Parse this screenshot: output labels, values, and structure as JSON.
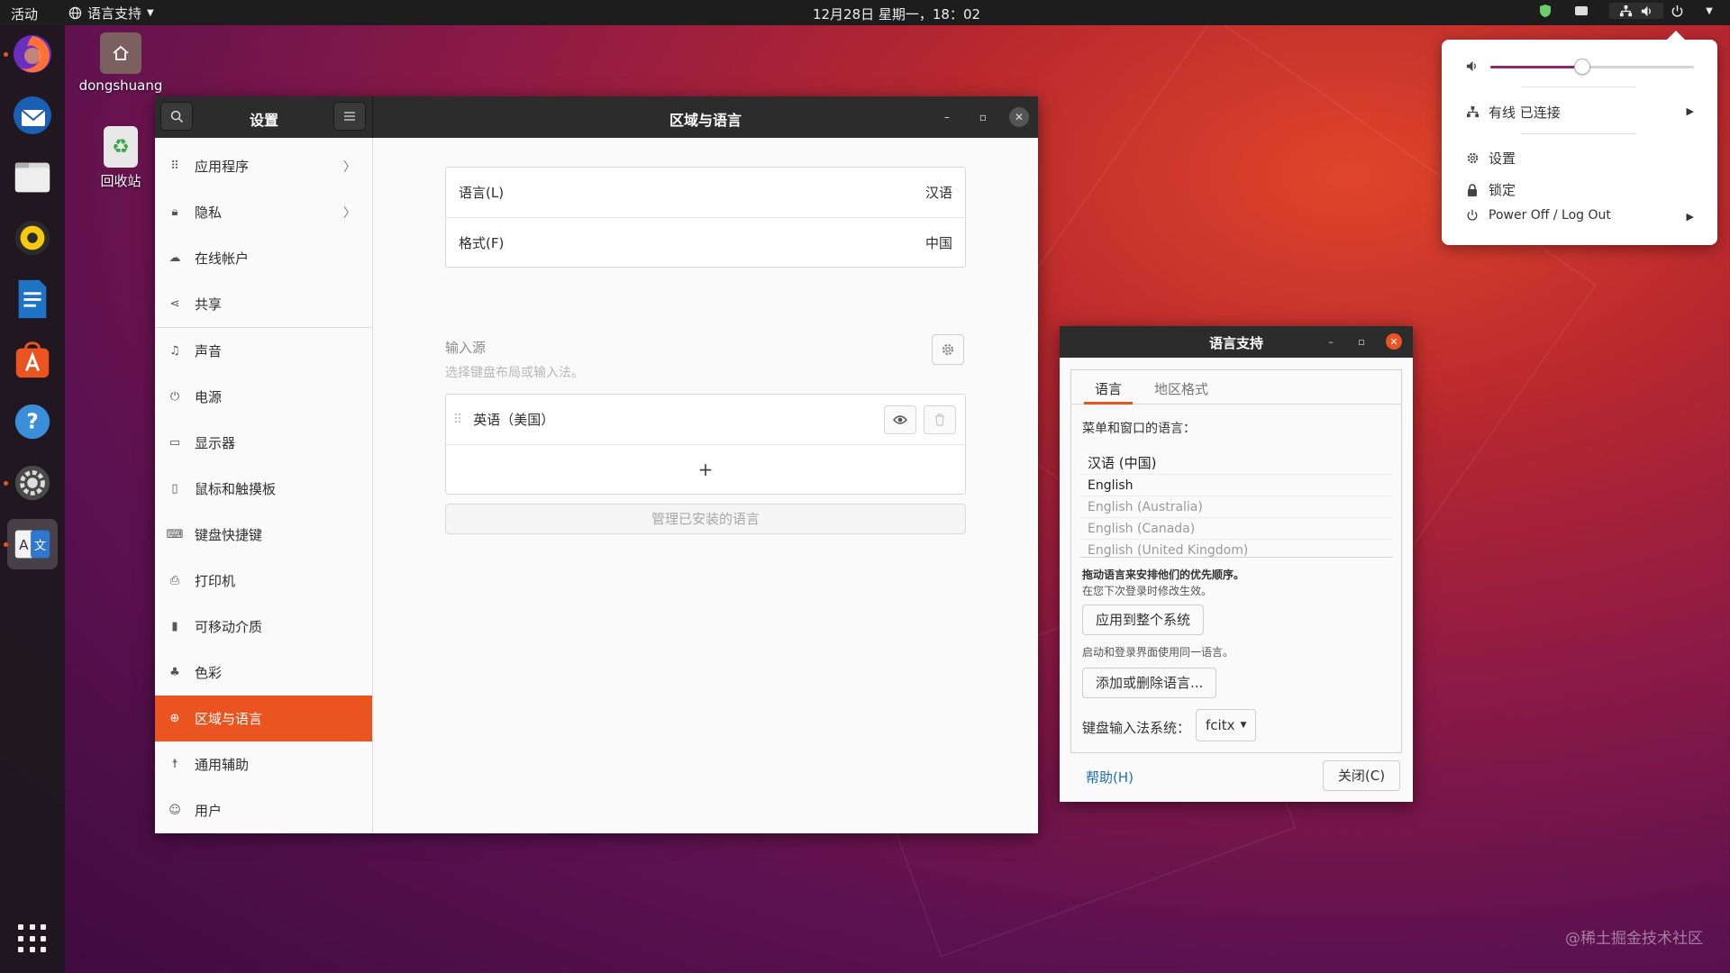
{
  "topbar": {
    "activities": "活动",
    "app_menu": "语言支持",
    "clock": "12月28日 星期一，18：02"
  },
  "desktop": {
    "home_label": "dongshuang",
    "trash_label": "回收站"
  },
  "settings": {
    "sidebar_title": "设置",
    "page_title": "区域与语言",
    "sidebar_items": [
      {
        "label": "应用程序",
        "icon": "apps-icon"
      },
      {
        "label": "隐私",
        "icon": "lock-icon"
      },
      {
        "label": "在线帐户",
        "icon": "cloud-icon"
      },
      {
        "label": "共享",
        "icon": "share-icon"
      },
      {
        "label": "声音",
        "icon": "music-note-icon"
      },
      {
        "label": "电源",
        "icon": "power-icon"
      },
      {
        "label": "显示器",
        "icon": "display-icon"
      },
      {
        "label": "鼠标和触摸板",
        "icon": "mouse-icon"
      },
      {
        "label": "键盘快捷键",
        "icon": "keyboard-icon"
      },
      {
        "label": "打印机",
        "icon": "printer-icon"
      },
      {
        "label": "可移动介质",
        "icon": "usb-icon"
      },
      {
        "label": "色彩",
        "icon": "color-icon"
      },
      {
        "label": "区域与语言",
        "icon": "globe-icon"
      },
      {
        "label": "通用辅助",
        "icon": "accessibility-icon"
      },
      {
        "label": "用户",
        "icon": "user-icon"
      }
    ],
    "language_label": "语言(L)",
    "language_value": "汉语",
    "format_label": "格式(F)",
    "format_value": "中国",
    "input_sources_title": "输入源",
    "input_sources_hint": "选择键盘布局或输入法。",
    "input_source_item": "英语（美国）",
    "add_symbol": "+",
    "manage_button": "管理已安装的语言"
  },
  "lang_support": {
    "title": "语言支持",
    "tab_language": "语言",
    "tab_region": "地区格式",
    "menu_label": "菜单和窗口的语言：",
    "languages": [
      "汉语 (中国)",
      "English",
      "English (Australia)",
      "English (Canada)",
      "English (United Kingdom)"
    ],
    "drag_hint": "拖动语言来安排他们的优先顺序。",
    "effect_hint": "在您下次登录时修改生效。",
    "apply_button": "应用到整个系统",
    "login_hint": "启动和登录界面使用同一语言。",
    "add_remove_button": "添加或删除语言...",
    "input_method_label": "键盘输入法系统：",
    "input_method_value": "fcitx",
    "help_button": "帮助(H)",
    "close_button": "关闭(C)"
  },
  "system_menu": {
    "volume_level": 0.45,
    "network": "有线 已连接",
    "settings": "设置",
    "lock": "锁定",
    "power": "Power Off / Log Out"
  },
  "watermark": "@稀土掘金技术社区",
  "colors": {
    "accent": "#e95420",
    "header_dark": "#2c2c2c",
    "topbar": "#1d1d1d",
    "link": "#1e6fb8"
  }
}
